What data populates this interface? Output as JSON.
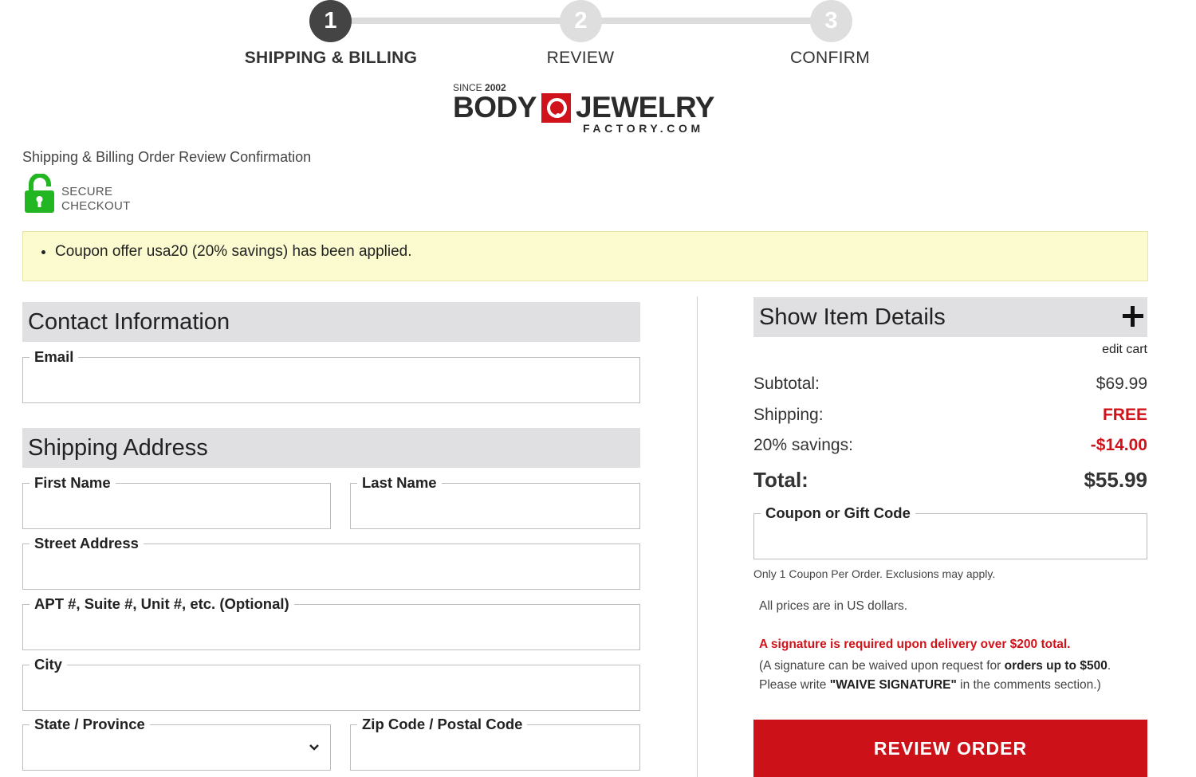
{
  "stepper": {
    "steps": [
      {
        "number": "1",
        "label": "SHIPPING & BILLING",
        "state": "active"
      },
      {
        "number": "2",
        "label": "REVIEW",
        "state": "inactive"
      },
      {
        "number": "3",
        "label": "CONFIRM",
        "state": "inactive"
      }
    ]
  },
  "logo": {
    "since_prefix": "SINCE ",
    "since_year": "2002",
    "word1": "BODY",
    "word2": "JEWELRY",
    "word3": "FACTORY.COM"
  },
  "breadcrumb": "Shipping & Billing Order Review Confirmation",
  "secure": {
    "line1": "SECURE",
    "line2": "CHECKOUT",
    "icon": "lock-icon",
    "color": "#23b623"
  },
  "notice": {
    "message": "Coupon offer usa20 (20% savings) has been applied."
  },
  "contact": {
    "title": "Contact Information",
    "email_label": "Email",
    "email_value": ""
  },
  "shipping": {
    "title": "Shipping Address",
    "first_name_label": "First Name",
    "last_name_label": "Last Name",
    "street_label": "Street Address",
    "apt_label": "APT #, Suite #, Unit #, etc. (Optional)",
    "city_label": "City",
    "state_label": "State / Province",
    "zip_label": "Zip Code / Postal Code"
  },
  "summary": {
    "details_title": "Show Item Details",
    "edit_cart": "edit cart",
    "subtotal_label": "Subtotal:",
    "subtotal_value": "$69.99",
    "shipping_label": "Shipping:",
    "shipping_value": "FREE",
    "savings_label": "20% savings:",
    "savings_value": "-$14.00",
    "total_label": "Total:",
    "total_value": "$55.99",
    "coupon_label": "Coupon or Gift Code",
    "coupon_note": "Only 1 Coupon Per Order. Exclusions may apply.",
    "prices_note": "All prices are in US dollars.",
    "signature_warning": "A signature is required upon delivery over $200 total.",
    "signature_note_1": "(A signature can be waived upon request for ",
    "signature_note_bold_1": "orders up to $500",
    "signature_note_2": ".",
    "signature_note_3": "Please write ",
    "signature_note_bold_2": "\"WAIVE SIGNATURE\"",
    "signature_note_4": " in the comments section.)"
  },
  "review_button": "REVIEW ORDER",
  "colors": {
    "accent_red": "#cc1118",
    "step_active": "#444444",
    "notice_bg": "#fbfbcf"
  }
}
